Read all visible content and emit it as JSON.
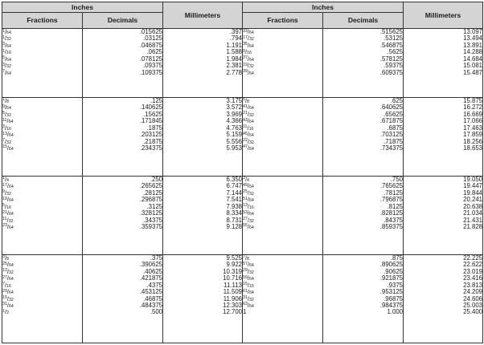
{
  "headers": {
    "inches": "Inches",
    "millimeters": "Millimeters",
    "fractions": "Fractions",
    "decimals": "Decimals"
  },
  "blocks": [
    {
      "left": [
        {
          "fraction": "1/64",
          "decimal": ".015625",
          "mm": ".397"
        },
        {
          "fraction": "1/32",
          "decimal": ".03125",
          "mm": ".794"
        },
        {
          "fraction": "3/64",
          "decimal": ".046875",
          "mm": "1.191"
        },
        {
          "fraction": "1/16",
          "decimal": ".0625",
          "mm": "1.588"
        },
        {
          "fraction": "5/64",
          "decimal": ".078125",
          "mm": "1.984"
        },
        {
          "fraction": "3/32",
          "decimal": ".09375",
          "mm": "2.381"
        },
        {
          "fraction": "7/64",
          "decimal": ".109375",
          "mm": "2.778"
        }
      ],
      "right": [
        {
          "fraction": "33/64",
          "decimal": ".515625",
          "mm": "13.097"
        },
        {
          "fraction": "17/32",
          "decimal": ".53125",
          "mm": "13.494"
        },
        {
          "fraction": "35/64",
          "decimal": ".546875",
          "mm": "13.891"
        },
        {
          "fraction": "9/16",
          "decimal": ".5625",
          "mm": "14.288"
        },
        {
          "fraction": "37/64",
          "decimal": ".578125",
          "mm": "14.684"
        },
        {
          "fraction": "19/32",
          "decimal": ".59375",
          "mm": "15.081"
        },
        {
          "fraction": "39/64",
          "decimal": ".609375",
          "mm": "15.487"
        }
      ]
    },
    {
      "left": [
        {
          "fraction": "1/8",
          "decimal": ".125",
          "mm": "3.175"
        },
        {
          "fraction": "9/64",
          "decimal": ".140625",
          "mm": "3.572"
        },
        {
          "fraction": "5/32",
          "decimal": ".15625",
          "mm": "3.969"
        },
        {
          "fraction": "11/64",
          "decimal": ".171845",
          "mm": "4.366"
        },
        {
          "fraction": "3/16",
          "decimal": ".1875",
          "mm": "4.763"
        },
        {
          "fraction": "13/64",
          "decimal": ".203125",
          "mm": "5.159"
        },
        {
          "fraction": "7/32",
          "decimal": ".21875",
          "mm": "5.556"
        },
        {
          "fraction": "15/64",
          "decimal": ".234375",
          "mm": "5.953"
        }
      ],
      "right": [
        {
          "fraction": "5/8",
          "decimal": ".625",
          "mm": "15.875"
        },
        {
          "fraction": "41/64",
          "decimal": ".640625",
          "mm": "16.272"
        },
        {
          "fraction": "21/32",
          "decimal": ".65625",
          "mm": "16.669"
        },
        {
          "fraction": "43/64",
          "decimal": ".671875",
          "mm": "17.066"
        },
        {
          "fraction": "11/16",
          "decimal": ".6875",
          "mm": "17.463"
        },
        {
          "fraction": "45/64",
          "decimal": ".703125",
          "mm": "17.859"
        },
        {
          "fraction": "22/32",
          "decimal": ".71875",
          "mm": "18.256"
        },
        {
          "fraction": "47/64",
          "decimal": ".734375",
          "mm": "18.653"
        }
      ]
    },
    {
      "left": [
        {
          "fraction": "1/4",
          "decimal": ".250",
          "mm": "6.350"
        },
        {
          "fraction": "17/64",
          "decimal": ".265625",
          "mm": "6.747"
        },
        {
          "fraction": "9/32",
          "decimal": ".28125",
          "mm": "7.144"
        },
        {
          "fraction": "19/64",
          "decimal": ".296875",
          "mm": "7.541"
        },
        {
          "fraction": "5/16",
          "decimal": ".3125",
          "mm": "7.938"
        },
        {
          "fraction": "21/64",
          "decimal": ".328125",
          "mm": "8.334"
        },
        {
          "fraction": "11/32",
          "decimal": ".34375",
          "mm": "8.731"
        },
        {
          "fraction": "23/64",
          "decimal": ".359375",
          "mm": "9.128"
        }
      ],
      "right": [
        {
          "fraction": "3/4",
          "decimal": ".750",
          "mm": "19.050"
        },
        {
          "fraction": "49/64",
          "decimal": ".765625",
          "mm": "19.447"
        },
        {
          "fraction": "25/32",
          "decimal": ".78125",
          "mm": "19.844"
        },
        {
          "fraction": "51/64",
          "decimal": ".796875",
          "mm": "20.241"
        },
        {
          "fraction": "13/16",
          "decimal": ".8125",
          "mm": "20.638"
        },
        {
          "fraction": "53/64",
          "decimal": ".828125",
          "mm": "21.034"
        },
        {
          "fraction": "27/32",
          "decimal": ".84375",
          "mm": "21.431"
        },
        {
          "fraction": "55/64",
          "decimal": ".859375",
          "mm": "21.828"
        }
      ]
    },
    {
      "left": [
        {
          "fraction": "3/8",
          "decimal": ".375",
          "mm": "9.525"
        },
        {
          "fraction": "25/64",
          "decimal": ".390625",
          "mm": "9.922"
        },
        {
          "fraction": "13/32",
          "decimal": ".40625",
          "mm": "10.319"
        },
        {
          "fraction": "27/64",
          "decimal": ".421875",
          "mm": "10.716"
        },
        {
          "fraction": "7/16",
          "decimal": ".4375",
          "mm": "11.113"
        },
        {
          "fraction": "29/64",
          "decimal": ".453125",
          "mm": "11.509"
        },
        {
          "fraction": "15/32",
          "decimal": ".46875",
          "mm": "11.906"
        },
        {
          "fraction": "31/64",
          "decimal": ".484375",
          "mm": "12.303"
        },
        {
          "fraction": "1/2",
          "decimal": ".500",
          "mm": "12.700"
        }
      ],
      "right": [
        {
          "fraction": "7/8",
          "decimal": ".875",
          "mm": "22.225"
        },
        {
          "fraction": "57/64",
          "decimal": ".890625",
          "mm": "22.622"
        },
        {
          "fraction": "29/32",
          "decimal": ".90625",
          "mm": "23.019"
        },
        {
          "fraction": "59/64",
          "decimal": ".921875",
          "mm": "23.416"
        },
        {
          "fraction": "15/16",
          "decimal": ".9375",
          "mm": "23.813"
        },
        {
          "fraction": "61/64",
          "decimal": ".953125",
          "mm": "24.209"
        },
        {
          "fraction": "31/32",
          "decimal": ".96875",
          "mm": "24.606"
        },
        {
          "fraction": "63/64",
          "decimal": ".984375",
          "mm": "25.003"
        },
        {
          "fraction": "1",
          "decimal": "1.000",
          "mm": "25.400"
        }
      ]
    }
  ]
}
